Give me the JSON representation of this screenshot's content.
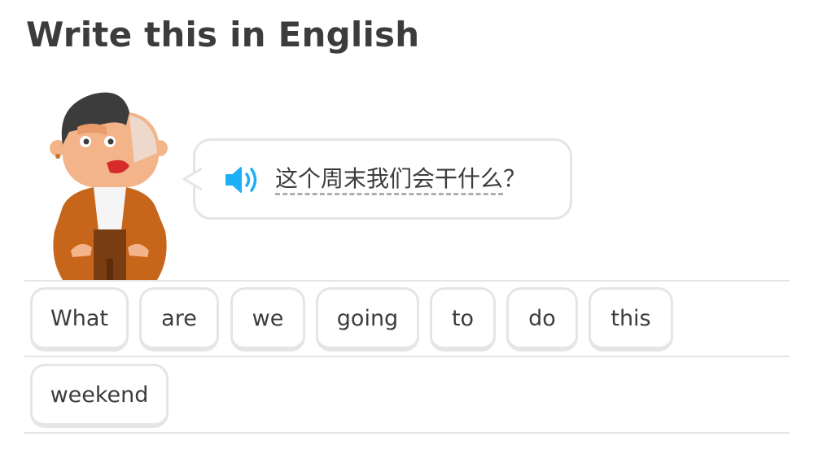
{
  "header": {
    "title": "Write this in English"
  },
  "prompt": {
    "text": "这个周末我们会干什么",
    "punctuation": "？",
    "speaker_icon": "speaker-icon",
    "speaker_color": "#1cb0f6"
  },
  "word_bank": {
    "rows": [
      [
        "What",
        "are",
        "we",
        "going",
        "to",
        "do",
        "this"
      ],
      [
        "weekend"
      ]
    ]
  },
  "colors": {
    "text": "#3c3c3c",
    "border": "#e5e5e5",
    "accent_blue": "#1cb0f6"
  }
}
